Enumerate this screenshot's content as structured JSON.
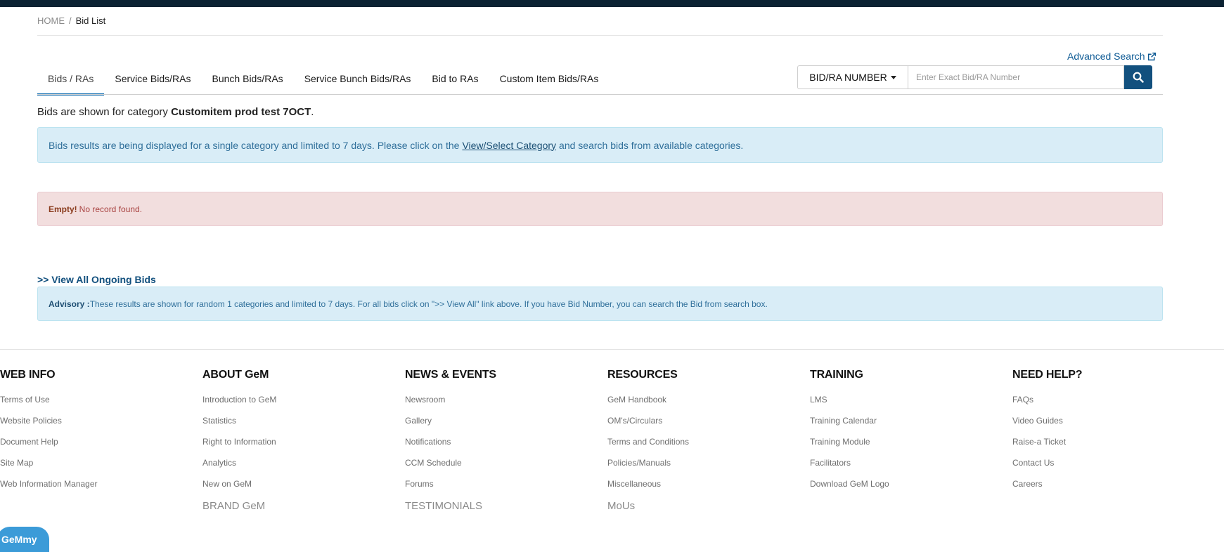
{
  "breadcrumb": {
    "home": "HOME",
    "separator": "/",
    "current": "Bid List"
  },
  "advanced_search": "Advanced Search",
  "tabs": [
    {
      "label": "Bids / RAs",
      "active": true
    },
    {
      "label": "Service Bids/RAs",
      "active": false
    },
    {
      "label": "Bunch Bids/RAs",
      "active": false
    },
    {
      "label": "Service Bunch Bids/RAs",
      "active": false
    },
    {
      "label": "Bid to RAs",
      "active": false
    },
    {
      "label": "Custom Item Bids/RAs",
      "active": false
    }
  ],
  "search": {
    "type_label": "BID/RA NUMBER",
    "placeholder": "Enter Exact Bid/RA Number",
    "value": ""
  },
  "category": {
    "prefix": "Bids are shown for category ",
    "name": "Customitem prod test 7OCT",
    "suffix": "."
  },
  "info": {
    "text_before": "Bids results are being displayed for a single category and limited to 7 days. Please click on the",
    "link": "View/Select Category",
    "text_after": "and search bids from available categories."
  },
  "alert": {
    "strong": "Empty!",
    "text": "No record found."
  },
  "view_all": ">> View All Ongoing Bids",
  "advisory": {
    "strong": "Advisory :",
    "text": "These results are shown for random 1 categories and limited to 7 days. For all bids click on \">> View All\" link above. If you have Bid Number, you can search the Bid from search box."
  },
  "footer": {
    "web_info": {
      "title": "WEB INFO",
      "items": [
        "Terms of Use",
        "Website Policies",
        "Document Help",
        "Site Map",
        "Web Information Manager"
      ]
    },
    "about": {
      "title": "ABOUT GeM",
      "items": [
        "Introduction to GeM",
        "Statistics",
        "Right to Information",
        "Analytics",
        "New on GeM"
      ],
      "extra": "BRAND GeM"
    },
    "news": {
      "title": "NEWS & EVENTS",
      "items": [
        "Newsroom",
        "Gallery",
        "Notifications",
        "CCM Schedule",
        "Forums"
      ],
      "extra": "TESTIMONIALS"
    },
    "resources": {
      "title": "RESOURCES",
      "items": [
        "GeM Handbook",
        "OM's/Circulars",
        "Terms and Conditions",
        "Policies/Manuals",
        "Miscellaneous"
      ],
      "extra": "MoUs"
    },
    "training": {
      "title": "TRAINING",
      "items": [
        "LMS",
        "Training Calendar",
        "Training Module",
        "Facilitators",
        "Download GeM Logo"
      ]
    },
    "help": {
      "title": "NEED HELP?",
      "items": [
        "FAQs",
        "Video Guides",
        "Raise-a Ticket",
        "Contact Us",
        "Careers"
      ]
    }
  },
  "chatbot": "GeMmy",
  "colors": {
    "accent": "#12507e",
    "tab_active": "#0d6bb0",
    "info_bg": "#d9edf7",
    "alert_bg": "#f2dede",
    "chatbot": "#3b9bd8"
  },
  "icons": [
    "external-link-icon",
    "search-icon",
    "caret-down-icon"
  ]
}
